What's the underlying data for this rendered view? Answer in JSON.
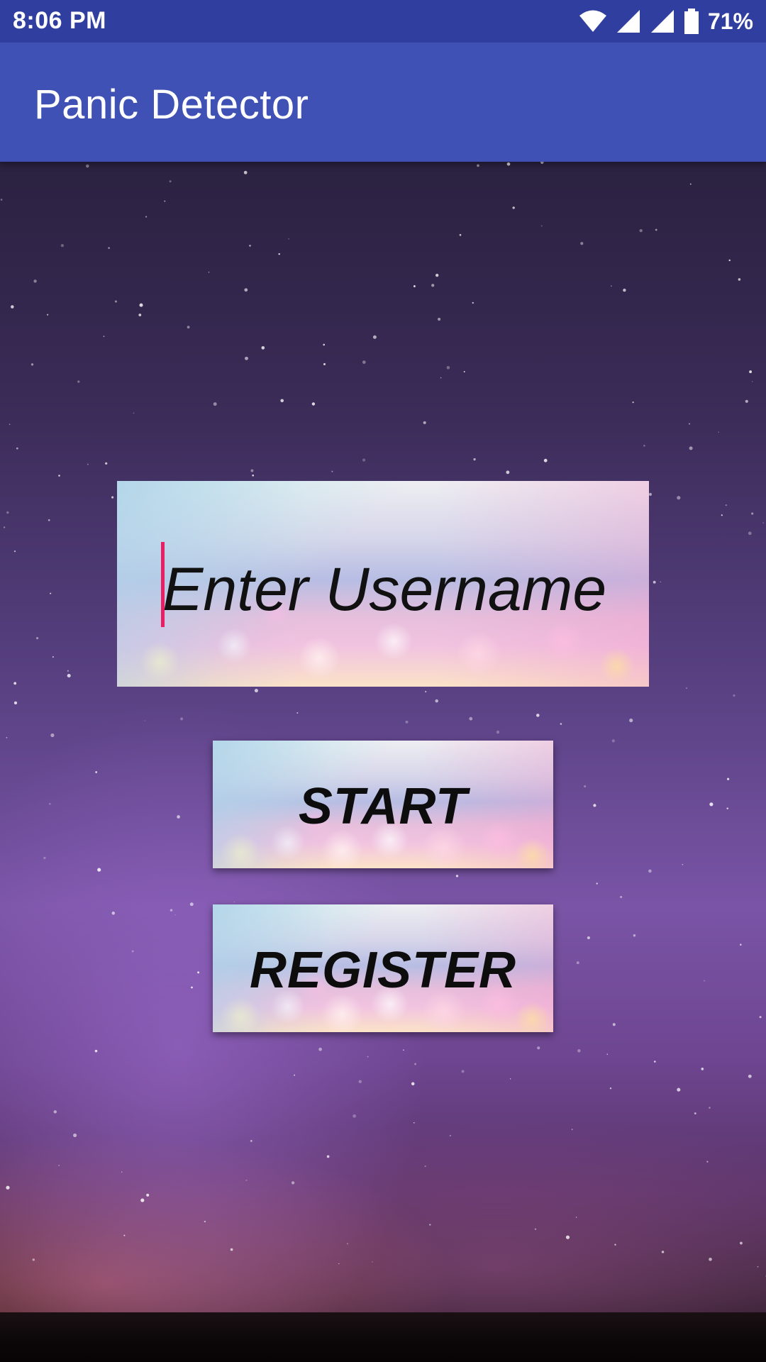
{
  "status_bar": {
    "time": "8:06 PM",
    "battery": "71%",
    "icons": [
      "wifi-icon",
      "signal-icon",
      "signal-icon",
      "battery-icon"
    ]
  },
  "app_bar": {
    "title": "Panic Detector"
  },
  "form": {
    "username_placeholder": "Enter Username",
    "username_value": ""
  },
  "buttons": {
    "start_label": "START",
    "register_label": "REGISTER"
  },
  "colors": {
    "status_bar": "#303f9f",
    "app_bar": "#3f51b5",
    "cursor_accent": "#e91e63"
  }
}
